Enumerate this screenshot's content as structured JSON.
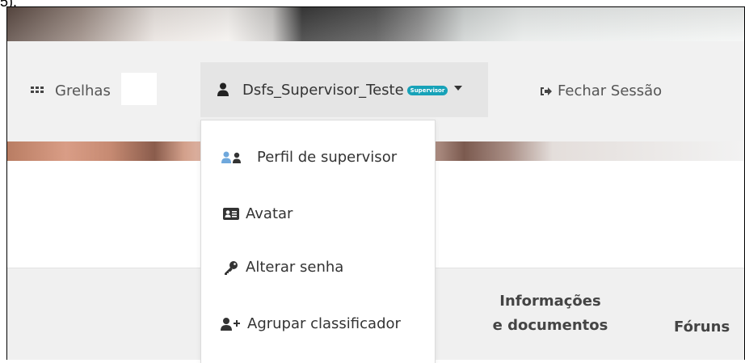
{
  "stray": {
    "text": "5)."
  },
  "nav": {
    "grelhas_label": "Grelhas",
    "user_name": "Dsfs_Supervisor_Teste",
    "user_badge": "Supervisor",
    "logout_label": "Fechar Sessão"
  },
  "dropdown": {
    "items": [
      {
        "label": "Perfil de supervisor",
        "icon": "users-icon"
      },
      {
        "label": "Avatar",
        "icon": "id-card-icon"
      },
      {
        "label": "Alterar senha",
        "icon": "key-icon"
      },
      {
        "label": "Agrupar classificador",
        "icon": "user-plus-icon"
      }
    ]
  },
  "tabs": {
    "info_line1": "Informações",
    "info_line2": "e documentos",
    "foruns": "Fóruns"
  },
  "colors": {
    "badge": "#17a2b8",
    "perfil_icon": "#6fa8dc",
    "navbar_bg": "#f1f1f1",
    "user_toggle_bg": "#e5e5e5"
  }
}
